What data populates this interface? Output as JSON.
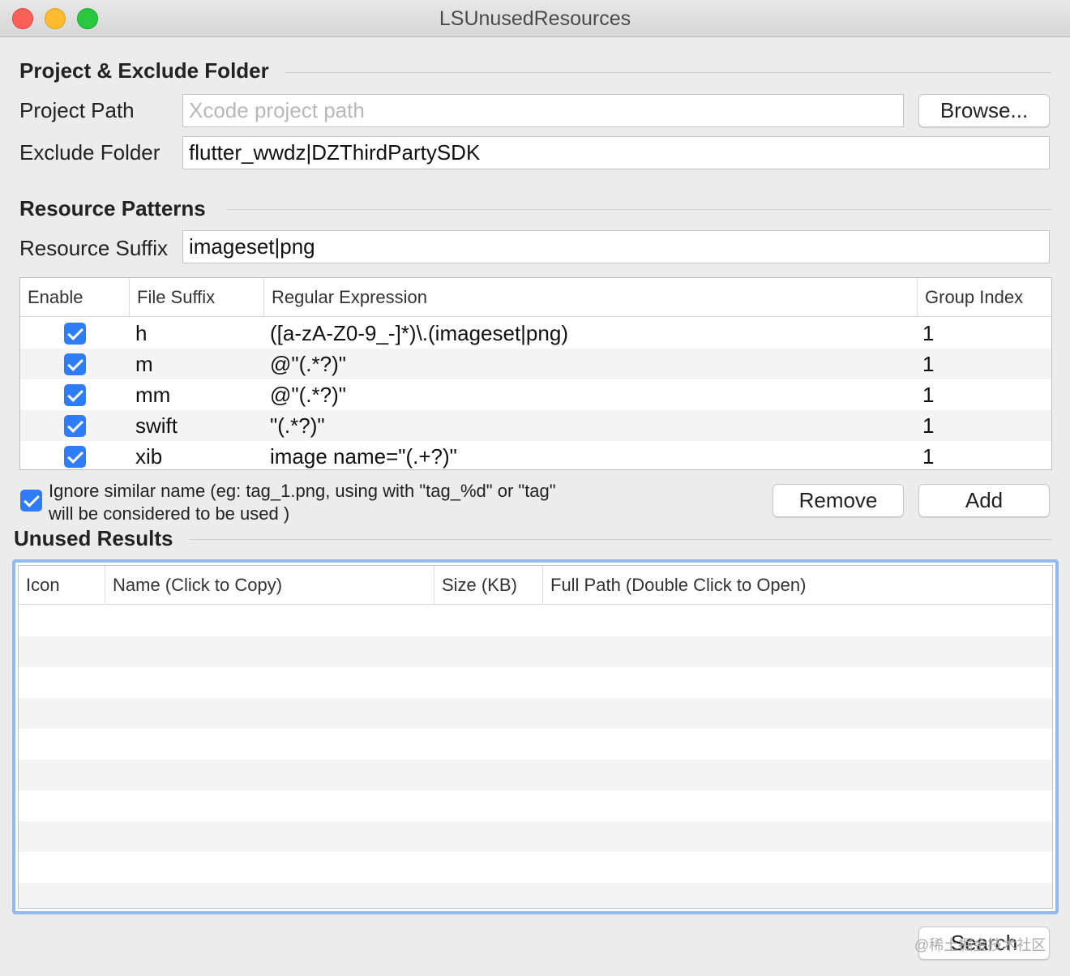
{
  "window": {
    "title": "LSUnusedResources"
  },
  "project_section": {
    "title": "Project & Exclude Folder",
    "project_path_label": "Project Path",
    "project_path_placeholder": "Xcode project path",
    "project_path_value": "",
    "browse_label": "Browse...",
    "exclude_folder_label": "Exclude Folder",
    "exclude_folder_value": "flutter_wwdz|DZThirdPartySDK"
  },
  "patterns_section": {
    "title": "Resource Patterns",
    "resource_suffix_label": "Resource Suffix",
    "resource_suffix_value": "imageset|png",
    "columns": [
      "Enable",
      "File Suffix",
      "Regular Expression",
      "Group Index"
    ],
    "rows": [
      {
        "enabled": true,
        "suffix": "h",
        "regex": "([a-zA-Z0-9_-]*)\\.(imageset|png)",
        "group": "1"
      },
      {
        "enabled": true,
        "suffix": "m",
        "regex": "@\"(.*?)\"",
        "group": "1"
      },
      {
        "enabled": true,
        "suffix": "mm",
        "regex": "@\"(.*?)\"",
        "group": "1"
      },
      {
        "enabled": true,
        "suffix": "swift",
        "regex": "\"(.*?)\"",
        "group": "1"
      },
      {
        "enabled": true,
        "suffix": "xib",
        "regex": "image name=\"(.+?)\"",
        "group": "1"
      }
    ],
    "ignore_similar_checked": true,
    "ignore_similar_line1": "Ignore similar name (eg: tag_1.png, using with \"tag_%d\" or \"tag\"",
    "ignore_similar_line2": "will be considered to be used )",
    "remove_label": "Remove",
    "add_label": "Add"
  },
  "results_section": {
    "title": "Unused Results",
    "columns": [
      "Icon",
      "Name (Click to Copy)",
      "Size (KB)",
      "Full Path (Double Click to Open)"
    ],
    "rows": []
  },
  "search_label": "Search",
  "watermark": "@稀土掘金技术社区"
}
